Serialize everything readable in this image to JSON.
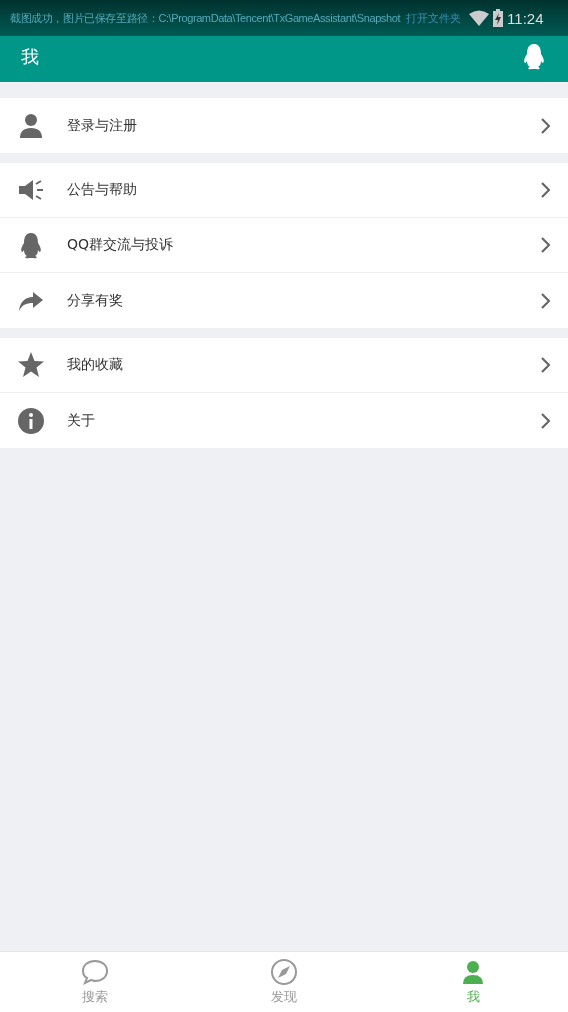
{
  "status_bar": {
    "toast": "截图成功，图片已保存至路径：C:\\ProgramData\\Tencent\\TxGameAssistant\\Snapshot",
    "toast_action": "打开文件夹",
    "time": "11:24"
  },
  "app_bar": {
    "title": "我"
  },
  "groups": [
    {
      "items": [
        {
          "kind": "person",
          "label": "登录与注册"
        }
      ]
    },
    {
      "items": [
        {
          "kind": "megaphone",
          "label": "公告与帮助"
        },
        {
          "kind": "penguin",
          "label": "QQ群交流与投诉"
        },
        {
          "kind": "share",
          "label": "分享有奖"
        }
      ]
    },
    {
      "items": [
        {
          "kind": "star",
          "label": "我的收藏"
        },
        {
          "kind": "info",
          "label": "关于"
        }
      ]
    }
  ],
  "bottom_nav": [
    {
      "kind": "chat",
      "label": "搜索",
      "selected": false
    },
    {
      "kind": "compass",
      "label": "发现",
      "selected": false
    },
    {
      "kind": "person",
      "label": "我",
      "selected": true
    }
  ]
}
